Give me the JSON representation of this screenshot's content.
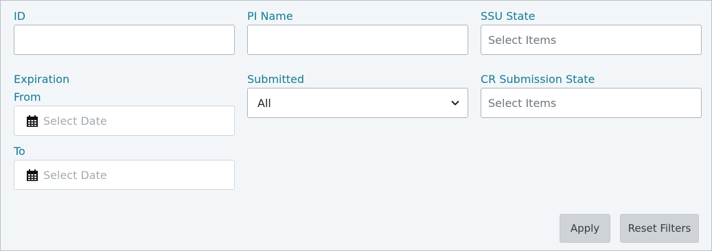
{
  "filters": {
    "id": {
      "label": "ID",
      "value": "",
      "placeholder": ""
    },
    "pi_name": {
      "label": "PI Name",
      "value": "",
      "placeholder": ""
    },
    "ssu_state": {
      "label": "SSU State",
      "placeholder": "Select Items"
    },
    "expiration": {
      "label": "Expiration",
      "from_label": "From",
      "from_placeholder": "Select Date",
      "to_label": "To",
      "to_placeholder": "Select Date"
    },
    "submitted": {
      "label": "Submitted",
      "selected": "All"
    },
    "cr_submission_state": {
      "label": "CR Submission State",
      "placeholder": "Select Items"
    }
  },
  "actions": {
    "apply_label": "Apply",
    "reset_label": "Reset Filters"
  },
  "colors": {
    "label": "#127a93",
    "panel_bg": "#f3f6f9",
    "button_bg": "#cfd3d8"
  },
  "icons": {
    "date": "calendar-icon",
    "select": "chevron-down-icon"
  }
}
